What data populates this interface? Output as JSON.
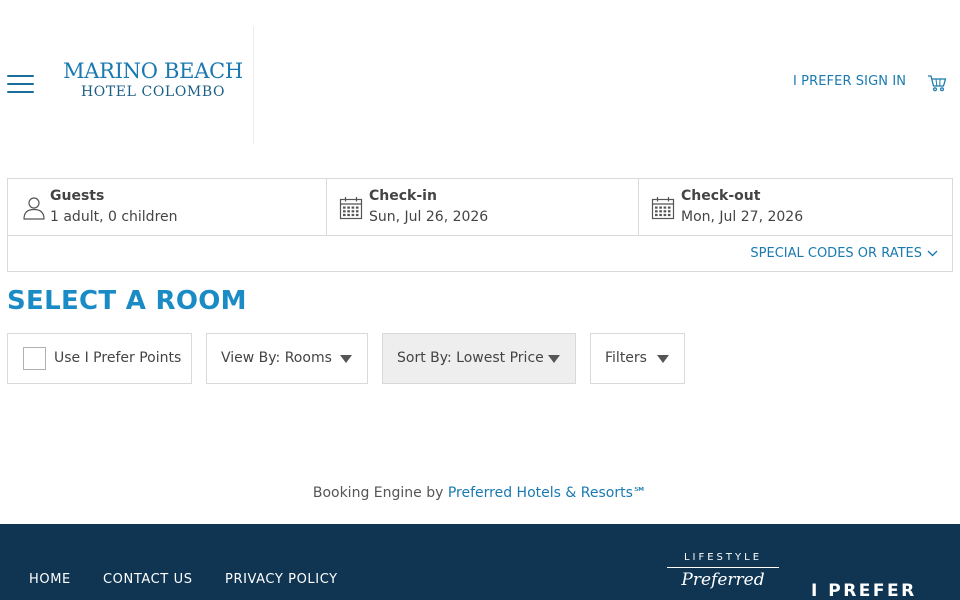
{
  "header": {
    "logo_line1": "MARINO BEACH",
    "logo_line2": "HOTEL COLOMBO",
    "signin_label": "I PREFER SIGN IN"
  },
  "booking": {
    "guests_label": "Guests",
    "guests_value": "1 adult, 0 children",
    "checkin_label": "Check-in",
    "checkin_value": "Sun, Jul 26, 2026",
    "checkout_label": "Check-out",
    "checkout_value": "Mon, Jul 27, 2026",
    "special_label": "SPECIAL CODES OR RATES"
  },
  "main": {
    "title": "SELECT A ROOM",
    "points_label": "Use I Prefer Points",
    "viewby_label": "View By: Rooms",
    "sortby_label": "Sort By: Lowest Price",
    "filters_label": "Filters"
  },
  "powered": {
    "prefix": "Booking Engine by ",
    "link": "Preferred Hotels & Resorts℠"
  },
  "footer": {
    "links": [
      "HOME",
      "CONTACT US",
      "PRIVACY POLICY"
    ],
    "lp_line1": "LIFESTYLE",
    "lp_line2": "Preferred",
    "iprefer": "I PREFER"
  },
  "colors": {
    "brand_blue": "#1a79b0",
    "title_blue": "#1a8bc4",
    "footer_bg": "#0f3553"
  }
}
